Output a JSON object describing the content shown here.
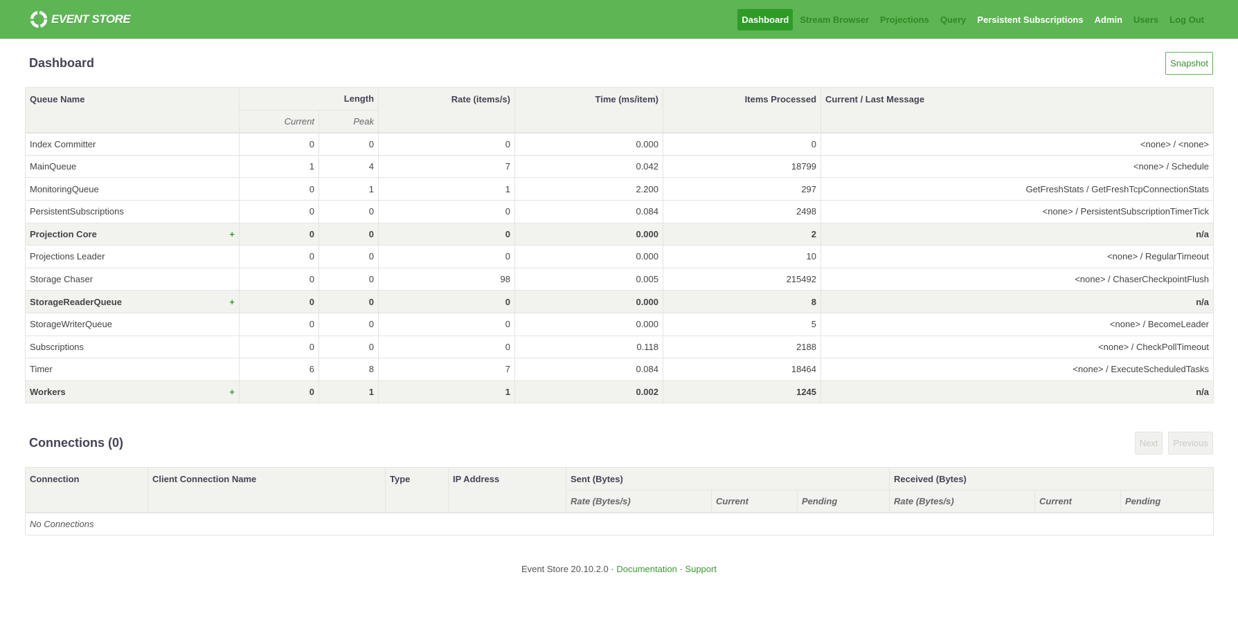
{
  "app": {
    "logo_text": "EVENT STORE",
    "brand_color": "#5db553",
    "accent_color": "#2e9b28"
  },
  "nav": {
    "items": [
      {
        "label": "Dashboard"
      },
      {
        "label": "Stream Browser"
      },
      {
        "label": "Projections"
      },
      {
        "label": "Query"
      },
      {
        "label": "Persistent Subscriptions"
      },
      {
        "label": "Admin"
      },
      {
        "label": "Users"
      },
      {
        "label": "Log Out"
      }
    ]
  },
  "dashboard": {
    "title": "Dashboard",
    "snapshot_label": "Snapshot",
    "headers": {
      "queue_name": "Queue Name",
      "length": "Length",
      "current": "Current",
      "peak": "Peak",
      "rate": "Rate (items/s)",
      "time": "Time (ms/item)",
      "items_processed": "Items Processed",
      "message": "Current / Last Message"
    },
    "group_expand_symbol": "+",
    "rows": [
      {
        "name": "Index Committer",
        "current": "0",
        "peak": "0",
        "rate": "0",
        "time": "0.000",
        "processed": "0",
        "message": "<none> / <none>"
      },
      {
        "name": "MainQueue",
        "current": "1",
        "peak": "4",
        "rate": "7",
        "time": "0.042",
        "processed": "18799",
        "message": "<none> / Schedule"
      },
      {
        "name": "MonitoringQueue",
        "current": "0",
        "peak": "1",
        "rate": "1",
        "time": "2.200",
        "processed": "297",
        "message": "GetFreshStats / GetFreshTcpConnectionStats"
      },
      {
        "name": "PersistentSubscriptions",
        "current": "0",
        "peak": "0",
        "rate": "0",
        "time": "0.084",
        "processed": "2498",
        "message": "<none> / PersistentSubscriptionTimerTick"
      },
      {
        "name": "Projection Core",
        "current": "0",
        "peak": "0",
        "rate": "0",
        "time": "0.000",
        "processed": "2",
        "message": "n/a"
      },
      {
        "name": "Projections Leader",
        "current": "0",
        "peak": "0",
        "rate": "0",
        "time": "0.000",
        "processed": "10",
        "message": "<none> / RegularTimeout"
      },
      {
        "name": "Storage Chaser",
        "current": "0",
        "peak": "0",
        "rate": "98",
        "time": "0.005",
        "processed": "215492",
        "message": "<none> / ChaserCheckpointFlush"
      },
      {
        "name": "StorageReaderQueue",
        "current": "0",
        "peak": "0",
        "rate": "0",
        "time": "0.000",
        "processed": "8",
        "message": "n/a"
      },
      {
        "name": "StorageWriterQueue",
        "current": "0",
        "peak": "0",
        "rate": "0",
        "time": "0.000",
        "processed": "5",
        "message": "<none> / BecomeLeader"
      },
      {
        "name": "Subscriptions",
        "current": "0",
        "peak": "0",
        "rate": "0",
        "time": "0.118",
        "processed": "2188",
        "message": "<none> / CheckPollTimeout"
      },
      {
        "name": "Timer",
        "current": "6",
        "peak": "8",
        "rate": "7",
        "time": "0.084",
        "processed": "18464",
        "message": "<none> / ExecuteScheduledTasks"
      },
      {
        "name": "Workers",
        "current": "0",
        "peak": "1",
        "rate": "1",
        "time": "0.002",
        "processed": "1245",
        "message": "n/a"
      }
    ]
  },
  "connections": {
    "title": "Connections (0)",
    "next_label": "Next",
    "previous_label": "Previous",
    "headers": {
      "connection": "Connection",
      "client_name": "Client Connection Name",
      "type": "Type",
      "ip": "IP Address",
      "sent": "Sent (Bytes)",
      "received": "Received (Bytes)",
      "rate": "Rate (Bytes/s)",
      "current": "Current",
      "pending": "Pending"
    },
    "empty_message": "No Connections"
  },
  "footer": {
    "version": "Event Store 20.10.2.0",
    "sep": "·",
    "documentation": "Documentation",
    "support": "Support"
  }
}
